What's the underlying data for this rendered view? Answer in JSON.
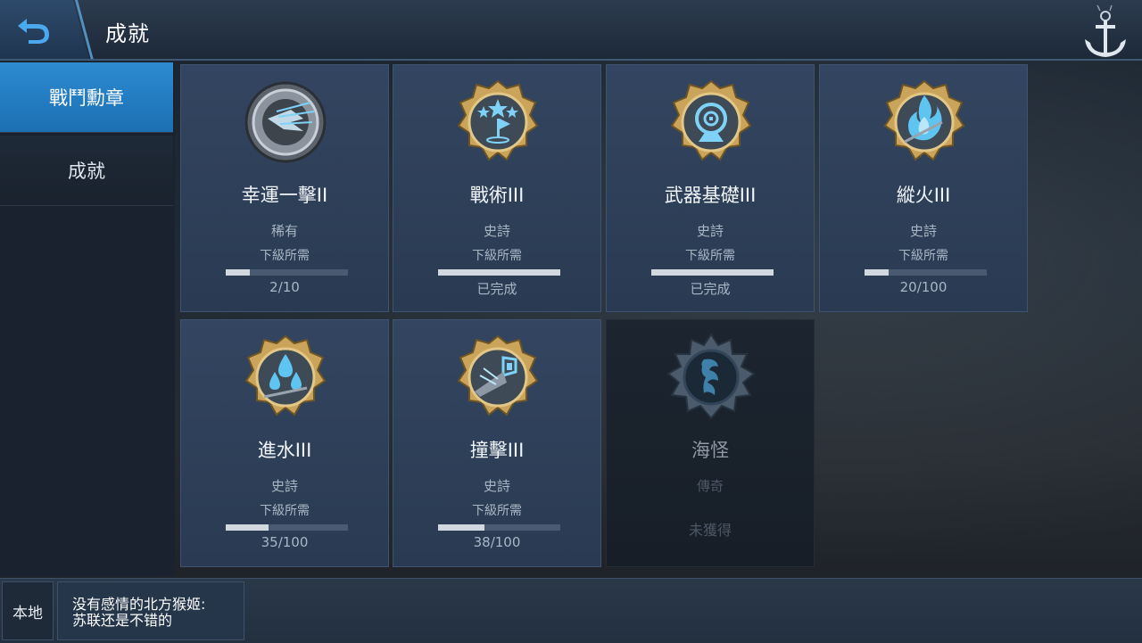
{
  "header": {
    "title": "成就"
  },
  "sidebar": {
    "items": [
      {
        "label": "戰鬥勳章"
      },
      {
        "label": "成就"
      }
    ]
  },
  "cards": [
    {
      "name": "幸運一擊II",
      "rarity": "稀有",
      "requirement": "下級所需",
      "progress_text": "2/10",
      "progress": 0.2,
      "icon": "lucky-strike-medal-icon"
    },
    {
      "name": "戰術III",
      "rarity": "史詩",
      "requirement": "下級所需",
      "progress_text": "已完成",
      "progress": 1.0,
      "icon": "tactics-medal-icon"
    },
    {
      "name": "武器基礎III",
      "rarity": "史詩",
      "requirement": "下級所需",
      "progress_text": "已完成",
      "progress": 1.0,
      "icon": "weapon-basics-medal-icon"
    },
    {
      "name": "縱火III",
      "rarity": "史詩",
      "requirement": "下級所需",
      "progress_text": "20/100",
      "progress": 0.2,
      "icon": "arson-medal-icon"
    },
    {
      "name": "進水III",
      "rarity": "史詩",
      "requirement": "下級所需",
      "progress_text": "35/100",
      "progress": 0.35,
      "icon": "flooding-medal-icon"
    },
    {
      "name": "撞擊III",
      "rarity": "史詩",
      "requirement": "下級所需",
      "progress_text": "38/100",
      "progress": 0.38,
      "icon": "ramming-medal-icon"
    },
    {
      "name": "海怪",
      "rarity": "傳奇",
      "status": "未獲得",
      "icon": "kraken-medal-icon"
    }
  ],
  "chat": {
    "channel": "本地",
    "message_line1": "没有感情的北方猴姬:",
    "message_line2": "苏联还是不错的"
  },
  "colors": {
    "accent": "#2d8bd0",
    "medal_gold": "#c9a45a",
    "medal_blue": "#5fc4f0"
  }
}
